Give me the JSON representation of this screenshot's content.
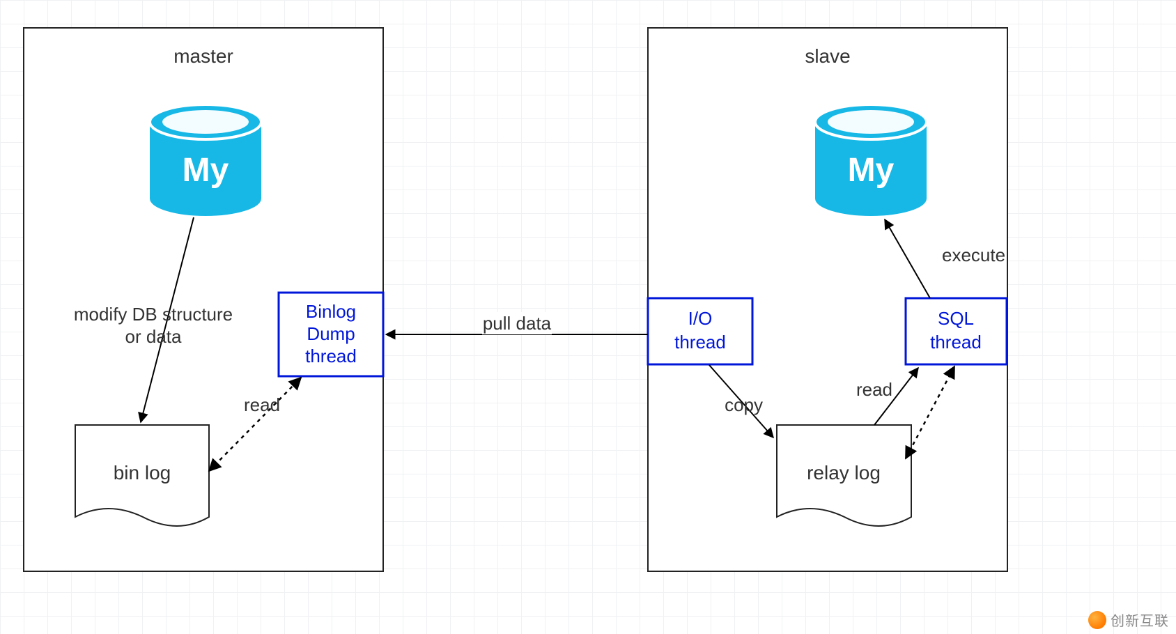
{
  "containers": {
    "master": {
      "title": "master"
    },
    "slave": {
      "title": "slave"
    }
  },
  "nodes": {
    "master_db_icon_text": "My",
    "slave_db_icon_text": "My",
    "binlog_dump_thread": {
      "line1": "Binlog",
      "line2": "Dump",
      "line3": "thread"
    },
    "io_thread": {
      "line1": "I/O",
      "line2": "thread"
    },
    "sql_thread": {
      "line1": "SQL",
      "line2": "thread"
    },
    "bin_log": "bin log",
    "relay_log": "relay log"
  },
  "edges": {
    "modify_db": {
      "line1": "modify DB structure",
      "line2": "or data"
    },
    "read_master": "read",
    "pull_data": "pull data",
    "copy": "copy",
    "read_slave": "read",
    "execute": "execute"
  },
  "watermark": "创新互联"
}
